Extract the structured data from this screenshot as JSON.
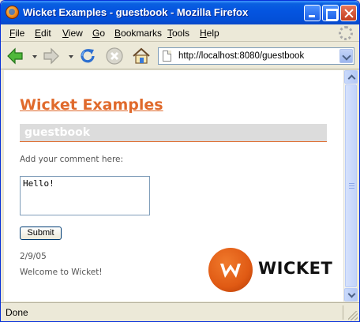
{
  "window": {
    "title": "Wicket Examples - guestbook - Mozilla Firefox"
  },
  "menubar": {
    "items": [
      "File",
      "Edit",
      "View",
      "Go",
      "Bookmarks",
      "Tools",
      "Help"
    ]
  },
  "navbar": {
    "url": "http://localhost:8080/guestbook",
    "icons": [
      "back-icon",
      "forward-icon",
      "reload-icon",
      "stop-icon",
      "home-icon"
    ]
  },
  "page": {
    "site_title": "Wicket Examples",
    "section_title": "guestbook",
    "prompt": "Add your comment here:",
    "comment_value": "Hello!",
    "submit_label": "Submit",
    "entries": [
      {
        "date": "2/9/05",
        "text": "Welcome to Wicket!"
      }
    ],
    "logo_text": "WICKET"
  },
  "statusbar": {
    "text": "Done"
  },
  "colors": {
    "accent": "#e06a2c",
    "titlebar": "#0454e0",
    "section_bar": "#dcdcdc"
  }
}
